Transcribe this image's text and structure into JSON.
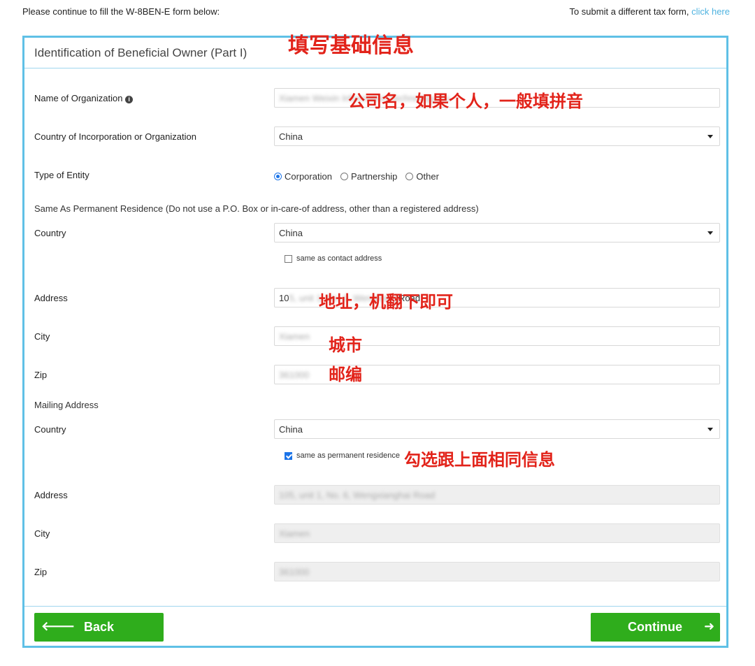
{
  "header": {
    "instruction": "Please continue to fill the W-8BEN-E form below:",
    "alt_form_text": "To submit a different tax form,",
    "alt_form_link": "click here"
  },
  "panel": {
    "title": "Identification of Beneficial Owner (Part I)"
  },
  "fields": {
    "org_name_label": "Name of Organization",
    "org_name_value": "Xiamen Weixin Information Technology Co.",
    "country_inc_label": "Country of Incorporation or Organization",
    "country_inc_value": "China",
    "entity_label": "Type of Entity",
    "entity_options": [
      "Corporation",
      "Partnership",
      "Other"
    ],
    "entity_selected": "Corporation"
  },
  "permanent": {
    "section_label": "Same As Permanent Residence (Do not use a P.O. Box or in-care-of address, other than a registered address)",
    "country_label": "Country",
    "country_value": "China",
    "same_contact_label": "same as contact address",
    "address_label": "Address",
    "address_value_prefix": "10",
    "address_value_blur": "5, unit 1, No. 6, Wengxiang",
    "address_value_suffix": "Road",
    "city_label": "City",
    "city_value": "Xiamen",
    "zip_label": "Zip",
    "zip_value": "361000"
  },
  "mailing": {
    "section_label": "Mailing Address",
    "country_label": "Country",
    "country_value": "China",
    "same_perm_label": "same as permanent residence",
    "address_label": "Address",
    "address_value": "105, unit 1, No. 6, Wengxianghai Road",
    "city_label": "City",
    "city_value": "Xiamen",
    "zip_label": "Zip",
    "zip_value": "361000"
  },
  "buttons": {
    "back": "Back",
    "continue": "Continue",
    "back_arrow": "🡐",
    "continue_arrow": "➜"
  },
  "annotations": {
    "basic_info": "填写基础信息",
    "company_name": "公司名，如果个人，一般填拼音",
    "address": "地址，机翻下即可",
    "city": "城市",
    "zip": "邮编",
    "same_info": "勾选跟上面相同信息"
  },
  "colors": {
    "accent_border": "#5fc0e6",
    "button_green": "#2fad1c",
    "annotation_red": "#e2231a",
    "link": "#4fb3e0"
  }
}
